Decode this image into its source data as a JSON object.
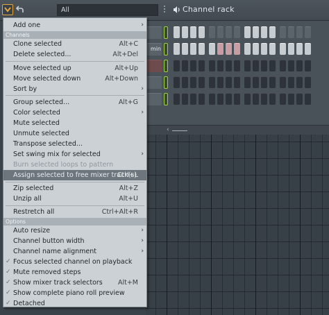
{
  "toolbar": {
    "filter_value": "All",
    "title": "Channel rack",
    "accent_color": "#e8a53b"
  },
  "rack": {
    "rows": [
      {
        "name_fragment": "",
        "name_color": "grey",
        "steps": "llllccccllllccccllllcccc"
      },
      {
        "name_fragment": "min",
        "name_color": "grey",
        "steps": "lllllpppllllllllllllllll"
      },
      {
        "name_fragment": "",
        "name_color": "red",
        "steps": "ddddddddddddddddddddddd"
      },
      {
        "name_fragment": "",
        "name_color": "grey",
        "steps": "ddddddddddddddddddddddd"
      },
      {
        "name_fragment": "",
        "name_color": "grey",
        "steps": "ddddddddddddddddddddddd"
      }
    ]
  },
  "menu": {
    "add_one": "Add one",
    "section_channels": "Channels",
    "clone": {
      "label": "Clone selected",
      "shortcut": "Alt+C"
    },
    "delete": {
      "label": "Delete selected...",
      "shortcut": "Alt+Del"
    },
    "move_up": {
      "label": "Move selected up",
      "shortcut": "Alt+Up"
    },
    "move_down": {
      "label": "Move selected down",
      "shortcut": "Alt+Down"
    },
    "sort_by": "Sort by",
    "group": {
      "label": "Group selected...",
      "shortcut": "Alt+G"
    },
    "color": "Color selected",
    "mute": "Mute selected",
    "unmute": "Unmute selected",
    "transpose": "Transpose selected...",
    "swing": "Set swing mix for selected",
    "burn": "Burn selected loops to pattern",
    "assign": {
      "label": "Assign selected to free mixer track(s)",
      "shortcut": "Ctrl+L"
    },
    "zip": {
      "label": "Zip selected",
      "shortcut": "Alt+Z"
    },
    "unzip": {
      "label": "Unzip all",
      "shortcut": "Alt+U"
    },
    "restretch": {
      "label": "Restretch all",
      "shortcut": "Ctrl+Alt+R"
    },
    "section_options": "Options",
    "auto_resize": "Auto resize",
    "button_width": "Channel button width",
    "name_alignment": "Channel name alignment",
    "focus_playback": "Focus selected channel on playback",
    "mute_removed": "Mute removed steps",
    "show_mixer": {
      "label": "Show mixer track selectors",
      "shortcut": "Alt+M"
    },
    "show_piano": "Show complete piano roll preview",
    "detached": "Detached"
  }
}
